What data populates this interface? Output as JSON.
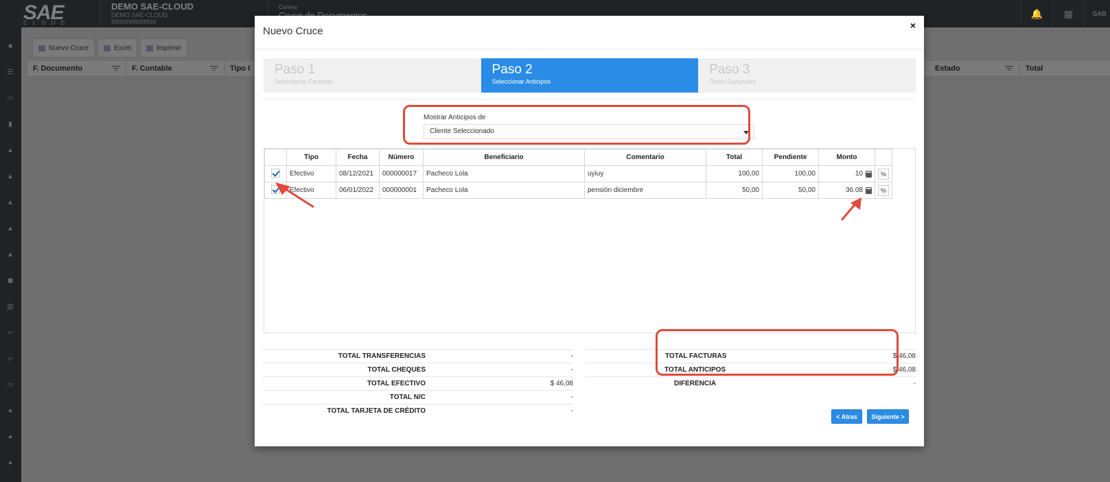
{
  "app": {
    "logo_text": "SAE",
    "logo_sub": "CLOUD",
    "company_name": "DEMO SAE-CLOUD",
    "company_sub": "DEMO SAE-CLOUD",
    "company_id": "9999999999999",
    "breadcrumb_section": "Cartera",
    "breadcrumb_page": "Cruce de Documentos",
    "user_initials": "GAB"
  },
  "toolbar": {
    "nuevo_cruce": "Nuevo Cruce",
    "excel": "Excel",
    "imprimir": "Imprimir"
  },
  "background_table": {
    "columns": [
      "F. Documento",
      "F. Contable",
      "Tipo I",
      "Estado",
      "Total"
    ]
  },
  "modal": {
    "title": "Nuevo Cruce",
    "close": "×",
    "steps": [
      {
        "title": "Paso 1",
        "subtitle": "Seleccionar Facturas"
      },
      {
        "title": "Paso 2",
        "subtitle": "Seleccionar Anticipos"
      },
      {
        "title": "Paso 3",
        "subtitle": "Datos Generales"
      }
    ],
    "active_step": 2,
    "mostrar": {
      "label": "Mostrar Anticipos de",
      "selected": "Cliente Seleccionado"
    },
    "table": {
      "headers": [
        "Tipo",
        "Fecha",
        "Número",
        "Beneficiario",
        "Comentario",
        "Total",
        "Pendiente",
        "Monto"
      ],
      "rows": [
        {
          "checked": true,
          "tipo": "Efectivo",
          "fecha": "08/12/2021",
          "numero": "000000017",
          "beneficiario": "Pacheco Lola",
          "comentario": "uyiuy",
          "total": "100,00",
          "pendiente": "100,00",
          "monto": "10"
        },
        {
          "checked": true,
          "tipo": "Efectivo",
          "fecha": "06/01/2022",
          "numero": "000000001",
          "beneficiario": "Pacheco Lola",
          "comentario": "pensión diciembre",
          "total": "50,00",
          "pendiente": "50,00",
          "monto": "36.08"
        }
      ]
    },
    "totals_left": [
      {
        "label": "TOTAL TRANSFERENCIAS",
        "value": "-"
      },
      {
        "label": "TOTAL CHEQUES",
        "value": "-"
      },
      {
        "label": "TOTAL EFECTIVO",
        "value": "$ 46,08"
      },
      {
        "label": "TOTAL N/C",
        "value": "-"
      },
      {
        "label": "TOTAL TARJETA DE CRÉDITO",
        "value": "-"
      }
    ],
    "totals_right": [
      {
        "label": "TOTAL FACTURAS",
        "value": "$ 46,08"
      },
      {
        "label": "TOTAL ANTICIPOS",
        "value": "$ 46,08"
      },
      {
        "label": "DIFERENCIA",
        "value": "-"
      }
    ],
    "buttons": {
      "atras": "< Atras",
      "siguiente": "Siguiente >"
    }
  },
  "colors": {
    "primary": "#2a8ce6",
    "annotation": "#e0493b",
    "overlay": "#6f6f6f",
    "topbar": "#1f2326"
  }
}
